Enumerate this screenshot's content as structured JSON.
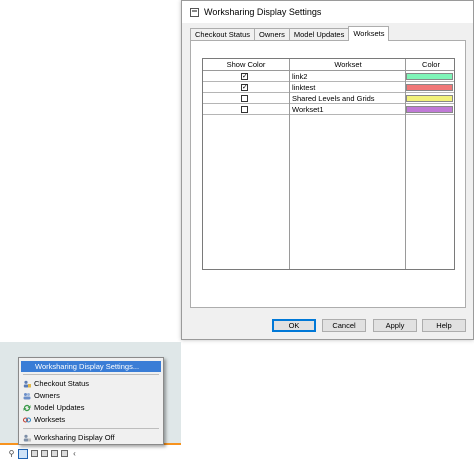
{
  "dialog": {
    "title": "Worksharing Display Settings",
    "tabs": [
      {
        "label": "Checkout Status",
        "active": false
      },
      {
        "label": "Owners",
        "active": false
      },
      {
        "label": "Model Updates",
        "active": false
      },
      {
        "label": "Worksets",
        "active": true
      }
    ],
    "table": {
      "headers": {
        "show_color": "Show Color",
        "workset": "Workset",
        "color": "Color"
      },
      "rows": [
        {
          "checked": true,
          "check_glyph": "✓",
          "name": "link2",
          "color": "#7ff5b8"
        },
        {
          "checked": true,
          "check_glyph": "✓",
          "name": "linktest",
          "color": "#f07878"
        },
        {
          "checked": false,
          "check_glyph": "",
          "name": "Shared Levels and Grids",
          "color": "#f2f27a"
        },
        {
          "checked": false,
          "check_glyph": "",
          "name": "Workset1",
          "color": "#c07ad6"
        }
      ]
    },
    "buttons": {
      "ok": "OK",
      "cancel": "Cancel",
      "apply": "Apply",
      "help": "Help"
    }
  },
  "context_menu": {
    "items": [
      {
        "label": "Worksharing Display Settings...",
        "icon": "",
        "highlighted": true
      },
      {
        "label": "Checkout Status",
        "icon": "checkout-status-icon"
      },
      {
        "label": "Owners",
        "icon": "owners-icon"
      },
      {
        "label": "Model Updates",
        "icon": "model-updates-icon"
      },
      {
        "label": "Worksets",
        "icon": "worksets-icon"
      },
      {
        "label": "Worksharing Display Off",
        "icon": "display-off-icon"
      }
    ]
  },
  "status_bar": {
    "icons": [
      "pin-icon",
      "worksharing-display-icon",
      "view-icon",
      "crop-icon",
      "lock-icon",
      "flag-icon",
      "chevron-left-icon"
    ],
    "glyph_pin": "⚲",
    "glyph_chevron": "‹"
  },
  "colors": {
    "menu_highlight": "#3a7dd6",
    "default_button_border": "#0078d7",
    "status_orange": "#f7931e"
  }
}
